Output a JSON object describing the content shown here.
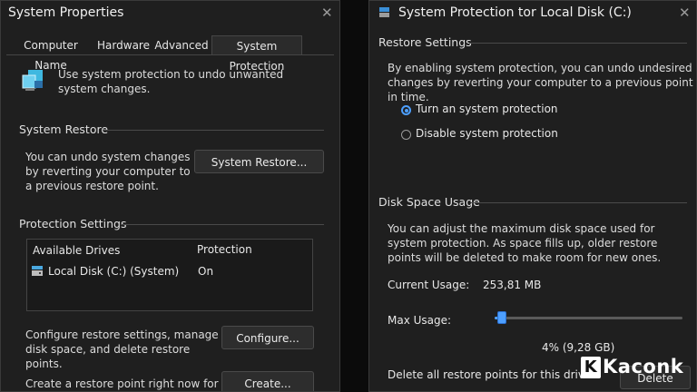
{
  "left_window": {
    "title": "System Properties",
    "tabs": [
      {
        "label": "Computer Name",
        "active": false
      },
      {
        "label": "Hardware",
        "active": false
      },
      {
        "label": "Advanced",
        "active": false
      },
      {
        "label": "System Protection",
        "active": true
      }
    ],
    "intro_text": "Use system protection to undo unwanted system changes.",
    "system_restore": {
      "header": "System Restore",
      "text": "You can undo system changes by reverting your computer to a previous restore point.",
      "button": "System Restore..."
    },
    "protection_settings": {
      "header": "Protection Settings",
      "columns": [
        "Available Drives",
        "Protection"
      ],
      "rows": [
        {
          "drive": "Local Disk (C:) (System)",
          "protection": "On"
        }
      ]
    },
    "configure": {
      "text": "Configure restore settings, manage disk space, and delete restore points.",
      "button": "Configure..."
    },
    "create": {
      "text": "Create a restore point right now for",
      "button": "Create..."
    }
  },
  "right_window": {
    "title": "System Protection tor Local Disk (C:)",
    "restore_settings": {
      "header": "Restore Settings",
      "text": "By enabling system protection, you can undo undesired changes by reverting your computer to a previous point in time.",
      "options": [
        {
          "label": "Turn an system protection",
          "selected": true
        },
        {
          "label": "Disable system protection",
          "selected": false
        }
      ]
    },
    "disk_space": {
      "header": "Disk Space Usage",
      "text": "You can adjust the maximum disk space used for system protection. As space fills up, older restore points will be deleted to make room for new ones.",
      "current_usage_label": "Current Usage:",
      "current_usage_value": "253,81 MB",
      "max_usage_label": "Max Usage:",
      "max_usage_fraction": 0.04,
      "max_usage_readout": "4% (9,28 GB)",
      "delete_text": "Delete all restore points for this drive.",
      "delete_button": "Delete"
    }
  },
  "watermark": {
    "letter": "K",
    "text": "Kaconk"
  },
  "colors": {
    "window_bg": "#1f1f1f",
    "accent": "#4d9fff"
  }
}
